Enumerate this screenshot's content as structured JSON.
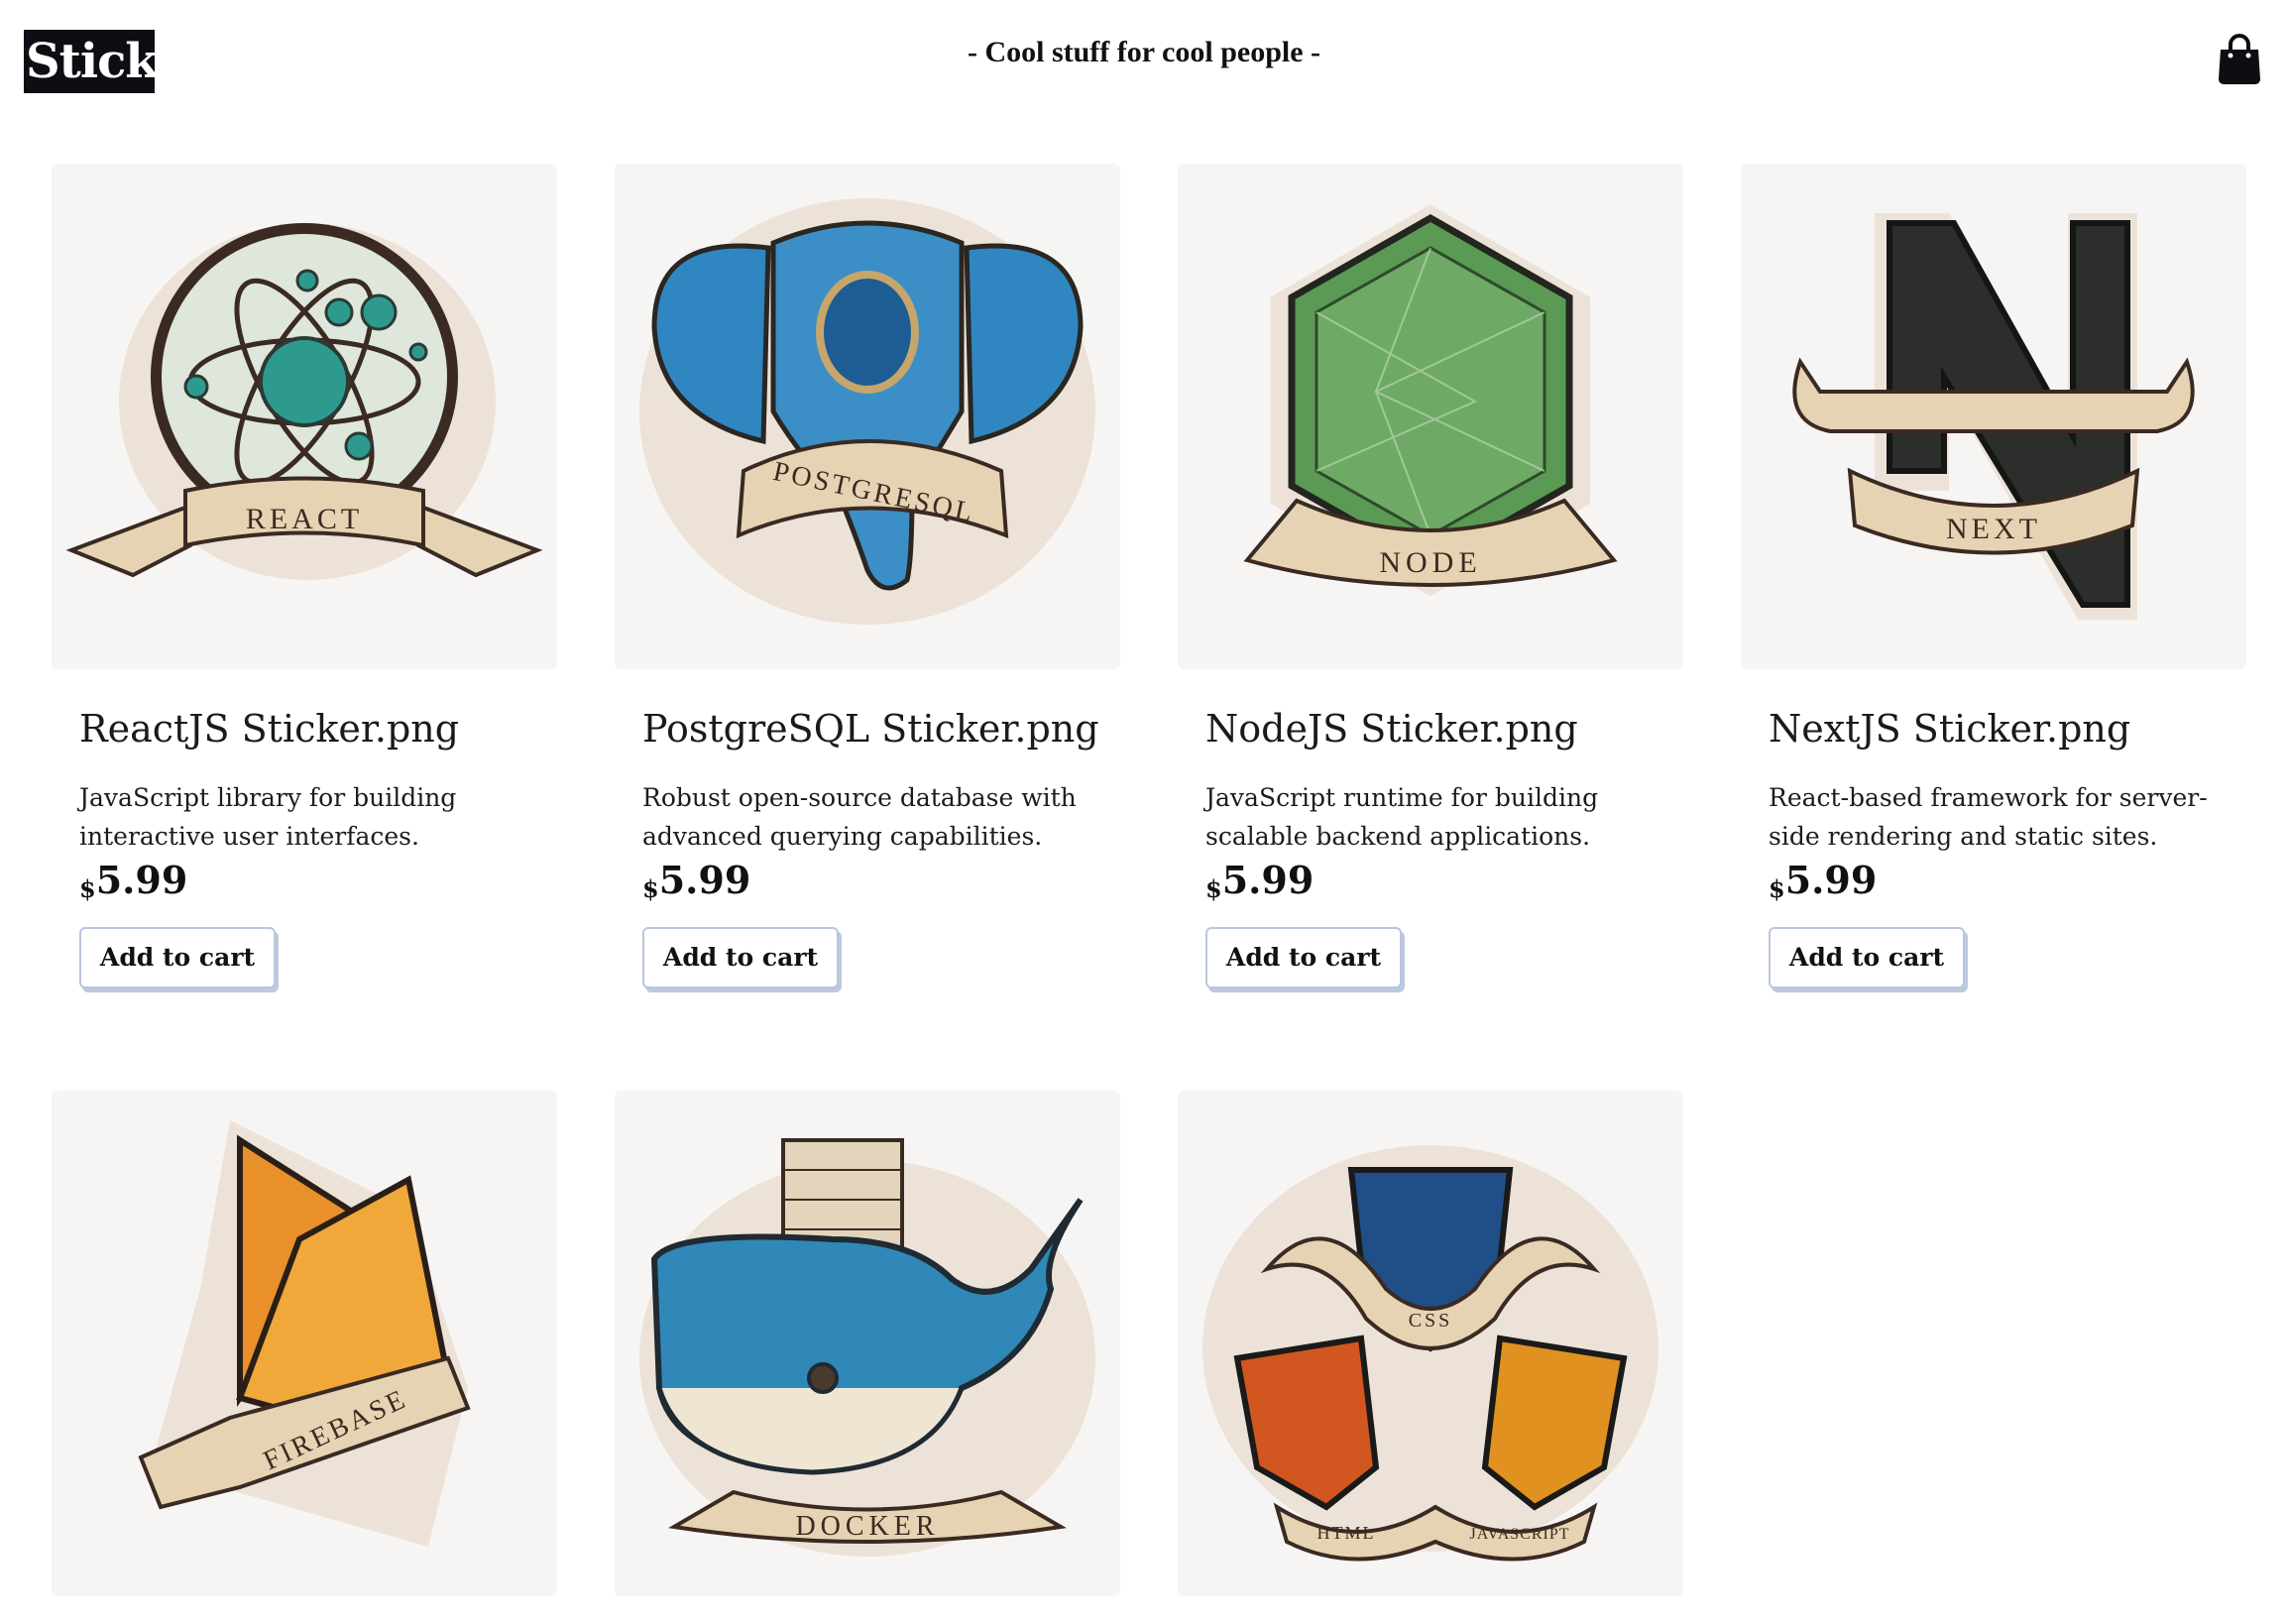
{
  "header": {
    "logo_text": "Stickr",
    "tagline": "- Cool stuff for cool people -",
    "cart_icon": "shopping-bag-icon"
  },
  "products": [
    {
      "title": "ReactJS Sticker.png",
      "description": "JavaScript library for building interactive user interfaces.",
      "currency": "$",
      "price": "5.99",
      "button": "Add to cart",
      "image": "react-sticker"
    },
    {
      "title": "PostgreSQL Sticker.png",
      "description": "Robust open-source database with advanced querying capabilities.",
      "currency": "$",
      "price": "5.99",
      "button": "Add to cart",
      "image": "postgresql-sticker"
    },
    {
      "title": "NodeJS Sticker.png",
      "description": "JavaScript runtime for building scalable backend applications.",
      "currency": "$",
      "price": "5.99",
      "button": "Add to cart",
      "image": "node-sticker"
    },
    {
      "title": "NextJS Sticker.png",
      "description": "React-based framework for server-side rendering and static sites.",
      "currency": "$",
      "price": "5.99",
      "button": "Add to cart",
      "image": "next-sticker"
    },
    {
      "image": "firebase-sticker"
    },
    {
      "image": "docker-sticker"
    },
    {
      "image": "html-css-javascript-sticker"
    }
  ],
  "sticker_labels": {
    "react": "REACT",
    "postgres": "POSTGRESQL",
    "node": "NODE",
    "next": "NEXT",
    "firebase": "FIREBASE",
    "docker": "DOCKER",
    "css": "CSS",
    "html": "HTML",
    "javascript": "JAVASCRIPT"
  },
  "colors": {
    "logo_bg": "#0d0d14",
    "button_border": "#b9c6dd",
    "banner": "#e6d3b3",
    "react_teal": "#2e9a8e",
    "postgres_blue": "#2f86c1",
    "node_green": "#5a9a55",
    "next_dark": "#2b2e2a",
    "firebase_orange": "#e9902a",
    "docker_blue": "#2f88b8",
    "html_orange": "#d1561f",
    "css_blue": "#1f4f86",
    "js_amber": "#e0911f"
  }
}
